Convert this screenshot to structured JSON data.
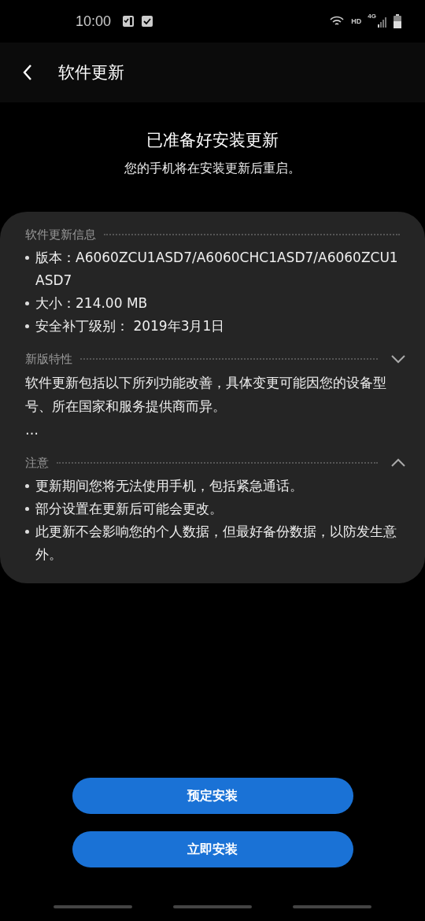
{
  "status_bar": {
    "time": "10:00",
    "network": "HD",
    "signal_type": "4G"
  },
  "header": {
    "title": "软件更新"
  },
  "intro": {
    "title": "已准备好安装更新",
    "subtitle": "您的手机将在安装更新后重启。"
  },
  "sections": [
    {
      "title": "软件更新信息",
      "kind": "list",
      "items": [
        "版本：A6060ZCU1ASD7/A6060CHC1ASD7/A6060ZCU1ASD7",
        "大小：214.00 MB",
        "安全补丁级别： 2019年3月1日"
      ]
    },
    {
      "title": "新版特性",
      "kind": "text",
      "expanded": false,
      "items": [
        "软件更新包括以下所列功能改善，具体变更可能因您的设备型号、所在国家和服务提供商而异。",
        "…"
      ]
    },
    {
      "title": "注意",
      "kind": "list",
      "expanded": true,
      "items": [
        "更新期间您将无法使用手机，包括紧急通话。",
        "部分设置在更新后可能会更改。",
        "此更新不会影响您的个人数据，但最好备份数据，以防发生意外。"
      ]
    }
  ],
  "buttons": [
    "预定安装",
    "立即安装"
  ]
}
